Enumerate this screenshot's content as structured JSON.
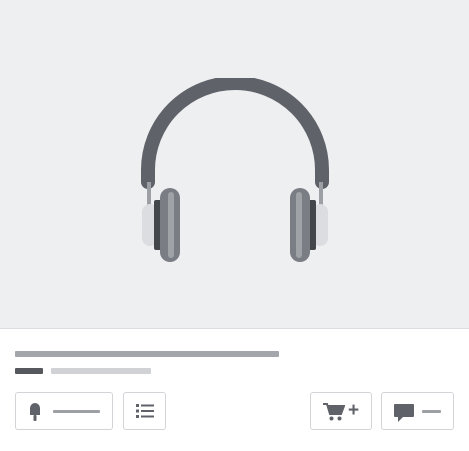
{
  "product": {
    "image_icon": "headphones-icon",
    "title_placeholder": "",
    "meta_placeholder": ""
  },
  "actions": {
    "like": {
      "icon": "popsicle-icon",
      "label": ""
    },
    "list": {
      "icon": "list-icon"
    },
    "add_to_cart": {
      "icon": "cart-icon",
      "badge": "+"
    },
    "comment": {
      "icon": "comment-icon",
      "label": ""
    }
  },
  "colors": {
    "hero_bg": "#eeeff1",
    "skeleton_dark": "#55585d",
    "skeleton_mid": "#a3a6aa",
    "skeleton_light": "#d0d2d6",
    "icon": "#5f6268"
  }
}
